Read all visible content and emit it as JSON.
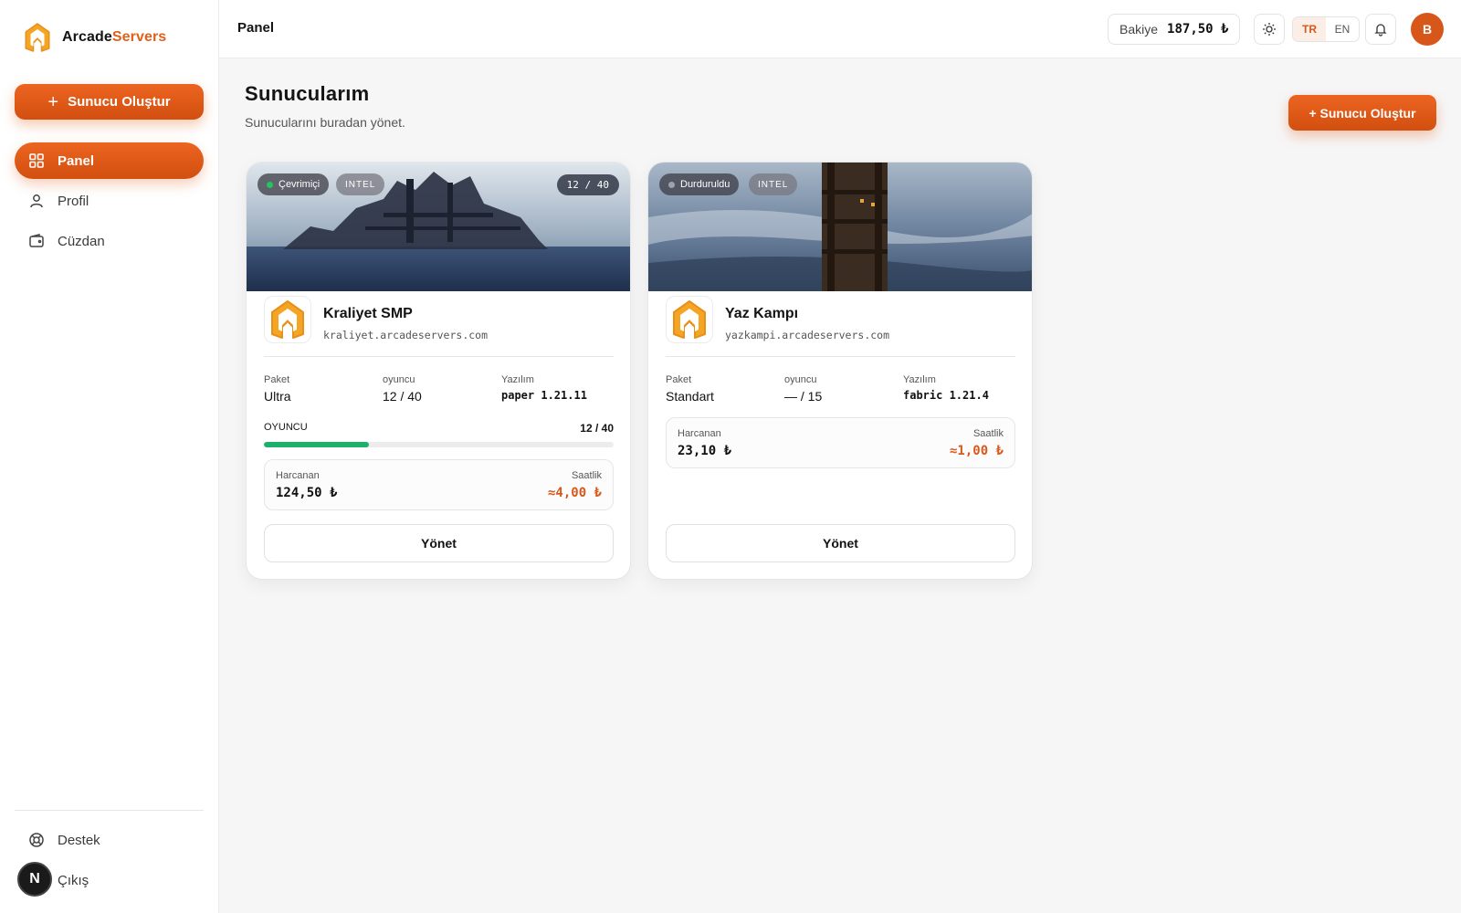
{
  "brand": {
    "name_part1": "Arcade",
    "name_part2": "Servers"
  },
  "sidebar": {
    "create_label": "Sunucu Oluştur",
    "items": [
      {
        "label": "Panel",
        "icon": "grid-icon",
        "active": true
      },
      {
        "label": "Profil",
        "icon": "user-icon",
        "active": false
      },
      {
        "label": "Cüzdan",
        "icon": "wallet-icon",
        "active": false
      }
    ],
    "bottom": [
      {
        "label": "Destek",
        "icon": "lifebuoy-icon"
      },
      {
        "label": "Çıkış",
        "icon": "logout-icon"
      }
    ],
    "badge": "N"
  },
  "header": {
    "title": "Panel",
    "balance_label": "Bakiye",
    "balance_value": "187,50 ₺",
    "languages": [
      "TR",
      "EN"
    ],
    "active_language": "TR",
    "avatar_initial": "B"
  },
  "main": {
    "title": "Sunucularım",
    "subtitle": "Sunucularını buradan yönet.",
    "create_label": "+ Sunucu Oluştur"
  },
  "servers": [
    {
      "status": "Çevrimiçi",
      "status_color": "#22c55e",
      "cpu": "INTEL",
      "player_badge": "12 / 40",
      "name": "Kraliyet SMP",
      "host": "kraliyet.arcadeservers.com",
      "package_label": "Paket",
      "package": "Ultra",
      "players_label": "oyuncu",
      "players": "12 / 40",
      "software_label": "Yazılım",
      "software": "paper 1.21.11",
      "bar_label": "OYUNCU",
      "bar_value": "12 / 40",
      "bar_fraction": 0.3,
      "spent_label": "Harcanan",
      "spent": "124,50 ₺",
      "hourly_label": "Saatlik",
      "hourly": "≈4,00 ₺",
      "manage_label": "Yönet"
    },
    {
      "status": "Durduruldu",
      "status_color": "#9ca3af",
      "cpu": "INTEL",
      "name": "Yaz Kampı",
      "host": "yazkampi.arcadeservers.com",
      "package_label": "Paket",
      "package": "Standart",
      "players_label": "oyuncu",
      "players": "— / 15",
      "software_label": "Yazılım",
      "software": "fabric 1.21.4",
      "spent_label": "Harcanan",
      "spent": "23,10 ₺",
      "hourly_label": "Saatlik",
      "hourly": "≈1,00 ₺",
      "manage_label": "Yönet"
    }
  ],
  "colors": {
    "accent": "#e0601a",
    "success": "#1eb06a"
  }
}
